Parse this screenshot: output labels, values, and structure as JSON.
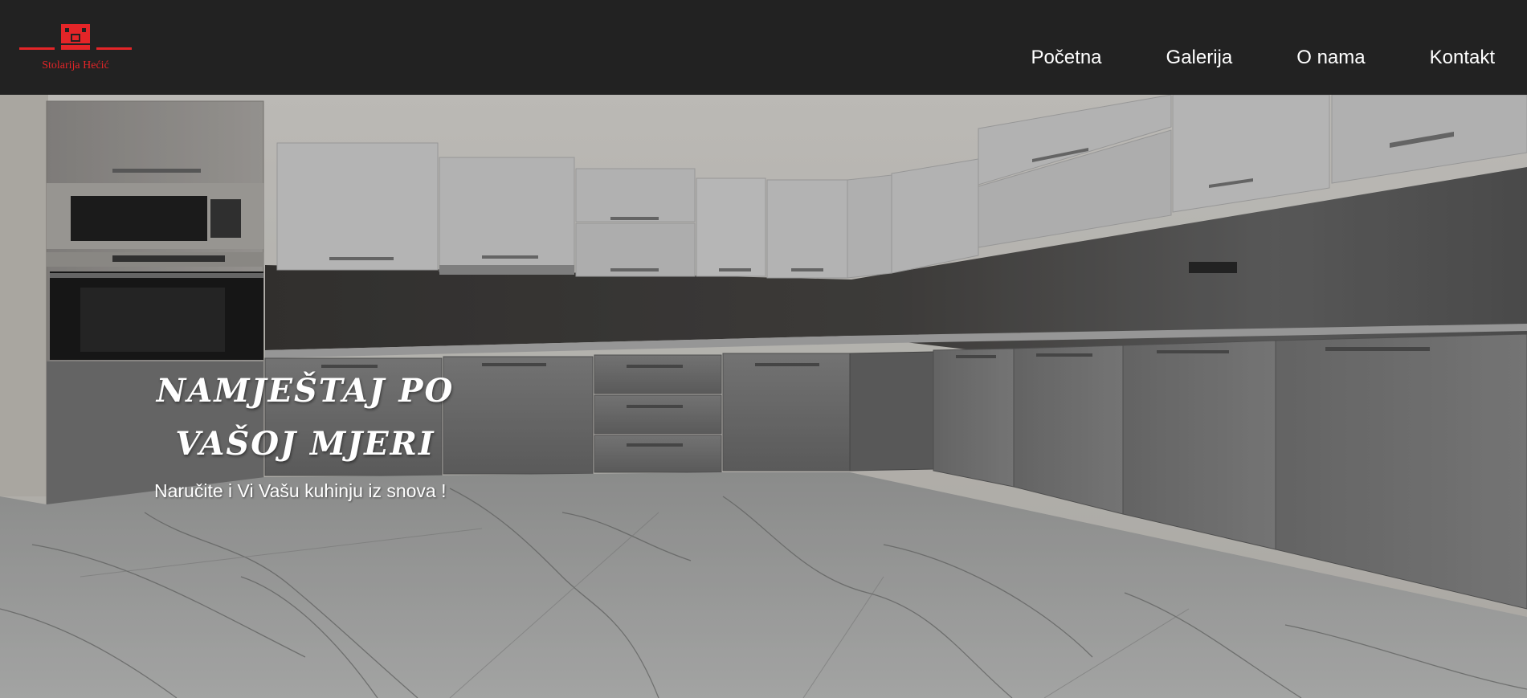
{
  "header": {
    "logo_text": "Stolarija Hećić",
    "nav": [
      {
        "label": "Početna"
      },
      {
        "label": "Galerija"
      },
      {
        "label": "O nama"
      },
      {
        "label": "Kontakt"
      }
    ]
  },
  "hero": {
    "title_line_1": "NAMJEŠTAJ PO",
    "title_line_2": "VAŠOJ MJERI",
    "subtitle": "Naručite i Vi Vašu kuhinju iz snova !"
  },
  "colors": {
    "header_background": "#222222",
    "logo_red": "#e42528",
    "nav_text": "#ffffff"
  },
  "icons": {
    "logo": "carpentry-logo-icon"
  }
}
